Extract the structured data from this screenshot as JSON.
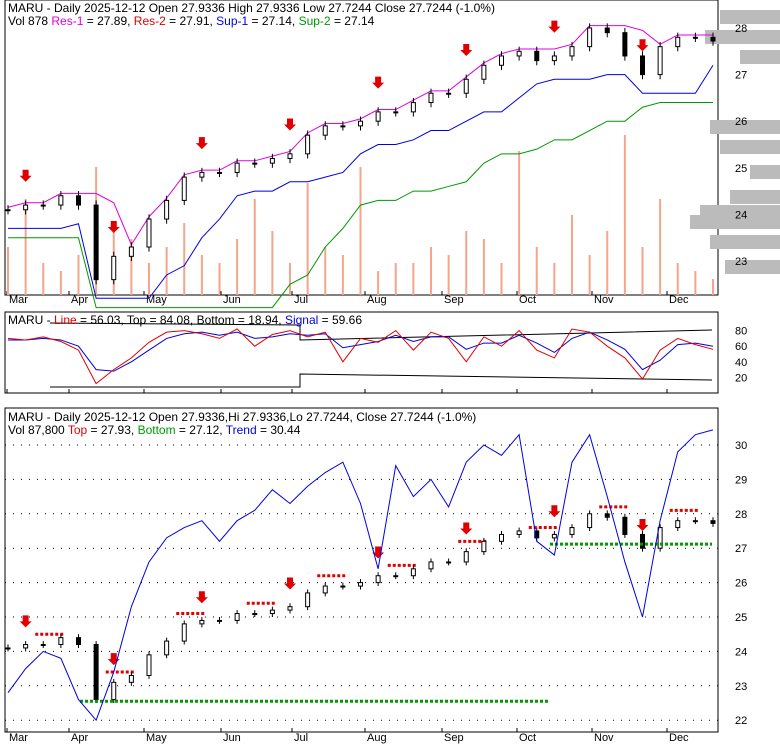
{
  "panel1": {
    "ticker": "MARU",
    "line1": "MARU - Daily 2025-12-12 Open 27.9336  High 27.9336  Low 27.7244  Close 27.7244 (-1.0%)",
    "vol": "Vol 878",
    "res1_label": "Res-1",
    "res1": " = 27.89, ",
    "res2_label": "Res-2",
    "res2": " = 27.91, ",
    "sup1_label": "Sup-1",
    "sup1": " = 27.14, ",
    "sup2_label": "Sup-2",
    "sup2": " = 27.14"
  },
  "panel2": {
    "prefix": "MARU - ",
    "line_label": "Line",
    "rest": " = 56.03, Top = 84.08, Bottom = 18.94, ",
    "signal_label": "Signal",
    "signal": " = 59.66"
  },
  "panel3": {
    "line1": "MARU - Daily 2025-12-12 Open 27.9336,Hi 27.9336,Lo 27.7244, Close 27.7244 (-1.0%)",
    "vol": "Vol 87,800 ",
    "top_label": "Top",
    "top": " = 27.93, ",
    "bottom_label": "Bottom",
    "bottom": " = 27.12, ",
    "trend_label": "Trend",
    "trend": " = 30.44"
  },
  "chart_data": {
    "type": "line",
    "months": [
      "Mar",
      "Apr",
      "May",
      "Jun",
      "Jul",
      "Aug",
      "Sep",
      "Oct",
      "Nov",
      "Dec"
    ],
    "price_axis_top": [
      "28",
      "27",
      "26",
      "25",
      "24",
      "23"
    ],
    "price_axis_bottom": [
      "30",
      "29",
      "28",
      "27",
      "26",
      "25",
      "24",
      "23",
      "22"
    ],
    "osc_axis": [
      "80",
      "60",
      "40",
      "20"
    ],
    "weekly_close": [
      24.1,
      24.2,
      24.2,
      24.4,
      24.2,
      22.6,
      23.1,
      23.3,
      23.9,
      24.3,
      24.8,
      24.9,
      24.9,
      25.1,
      25.1,
      25.2,
      25.3,
      25.7,
      25.9,
      25.9,
      26.0,
      26.2,
      26.2,
      26.4,
      26.6,
      26.6,
      26.9,
      27.2,
      27.4,
      27.5,
      27.3,
      27.4,
      27.6,
      28.0,
      27.9,
      27.4,
      27.0,
      27.6,
      27.8,
      27.8,
      27.72
    ],
    "weekly_volume": [
      30,
      60,
      20,
      15,
      25,
      80,
      40,
      35,
      20,
      30,
      45,
      25,
      20,
      35,
      60,
      40,
      20,
      70,
      30,
      25,
      80,
      15,
      20,
      20,
      30,
      25,
      40,
      35,
      20,
      90,
      30,
      20,
      50,
      25,
      40,
      100,
      30,
      60,
      20,
      15,
      10
    ],
    "osc_line": [
      70,
      68,
      72,
      66,
      55,
      12,
      30,
      45,
      65,
      78,
      80,
      76,
      70,
      82,
      60,
      75,
      80,
      72,
      78,
      40,
      70,
      65,
      80,
      55,
      78,
      70,
      40,
      72,
      60,
      80,
      55,
      45,
      82,
      78,
      60,
      45,
      18,
      55,
      70,
      62,
      56
    ],
    "osc_signal": [
      68,
      68,
      70,
      68,
      60,
      30,
      28,
      40,
      55,
      70,
      76,
      78,
      74,
      78,
      70,
      72,
      76,
      74,
      76,
      58,
      62,
      66,
      74,
      66,
      72,
      72,
      56,
      64,
      64,
      74,
      64,
      52,
      70,
      78,
      68,
      56,
      30,
      42,
      62,
      64,
      60
    ],
    "trend": [
      22.8,
      23.5,
      24.0,
      23.8,
      22.6,
      22.0,
      23.4,
      25.3,
      26.6,
      27.3,
      27.6,
      27.8,
      27.2,
      27.8,
      28.1,
      28.7,
      28.3,
      28.8,
      29.2,
      29.5,
      28.3,
      26.4,
      29.4,
      28.5,
      29.0,
      28.2,
      29.5,
      30.0,
      29.7,
      30.3,
      27.2,
      26.8,
      29.5,
      30.3,
      28.5,
      26.6,
      25.0,
      27.8,
      29.8,
      30.3,
      30.44
    ]
  }
}
